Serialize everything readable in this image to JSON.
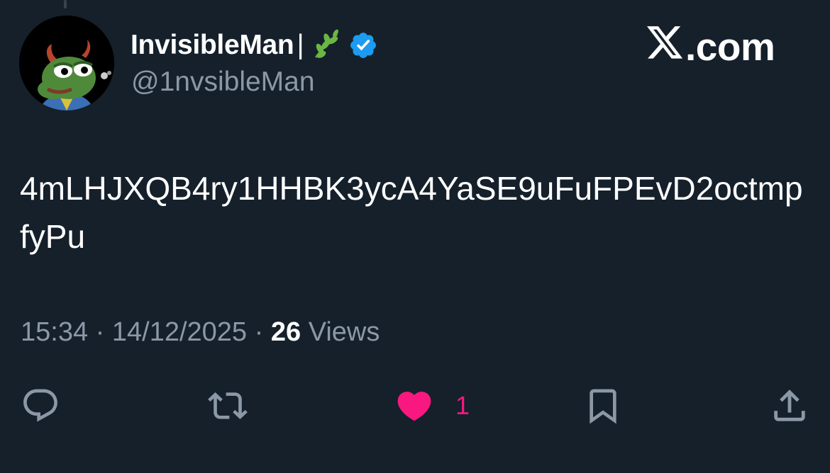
{
  "tweet": {
    "author": {
      "display_name": "InvisibleMan",
      "name_separator": "|",
      "handle": "@1nvsibleMan",
      "verified": true
    },
    "brand": {
      "text": ".com",
      "icon": "x-logo-icon"
    },
    "body": "4mLHJXQB4ry1HHBK3ycA4YaSE9uFuFPEvD2octmpfyPu",
    "meta": {
      "time": "15:34",
      "date": "14/12/2025",
      "separator": "·",
      "views_count": "26",
      "views_label": "Views"
    },
    "actions": {
      "reply_icon": "reply-icon",
      "retweet_icon": "retweet-icon",
      "like_icon": "heart-icon",
      "like_count": "1",
      "bookmark_icon": "bookmark-icon",
      "share_icon": "share-icon"
    }
  },
  "colors": {
    "background": "#15202b",
    "text_primary": "#ffffff",
    "text_secondary": "#8b98a5",
    "verified": "#1d9bf0",
    "like": "#f91880"
  }
}
